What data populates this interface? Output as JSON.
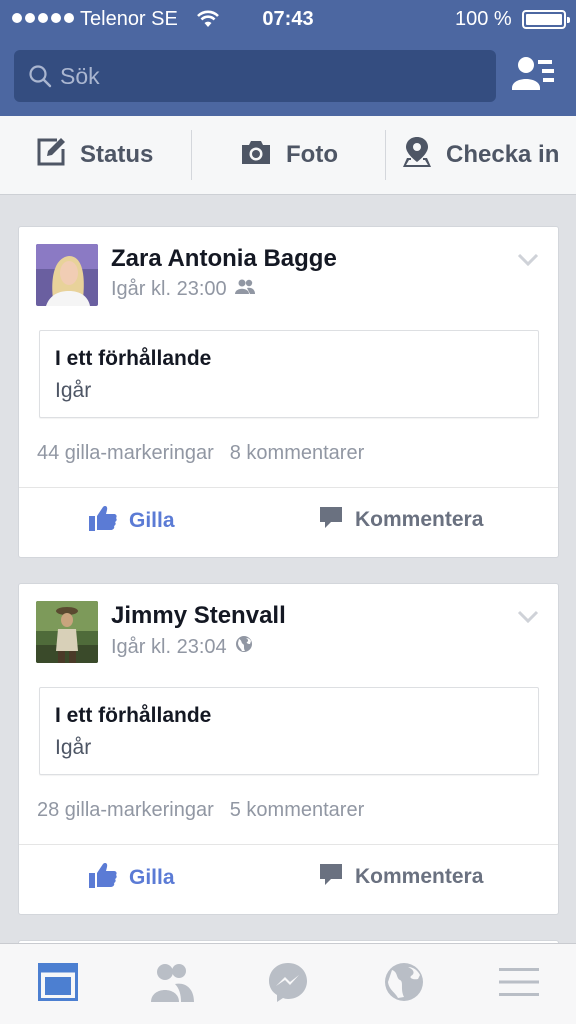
{
  "status_bar": {
    "carrier": "Telenor SE",
    "time": "07:43",
    "battery": "100 %"
  },
  "search": {
    "placeholder": "Sök"
  },
  "composer": {
    "status_label": "Status",
    "photo_label": "Foto",
    "checkin_label": "Checka in"
  },
  "posts": [
    {
      "author": "Zara Antonia Bagge",
      "time": "Igår kl. 23:00",
      "audience_icon": "friends-icon",
      "event_title": "I ett förhållande",
      "event_date": "Igår",
      "likes": "44 gilla-markeringar",
      "comments": "8 kommentarer",
      "like_label": "Gilla",
      "comment_label": "Kommentera"
    },
    {
      "author": "Jimmy Stenvall",
      "time": "Igår kl. 23:04",
      "audience_icon": "globe-icon",
      "event_title": "I ett förhållande",
      "event_date": "Igår",
      "likes": "28 gilla-markeringar",
      "comments": "5 kommentarer",
      "like_label": "Gilla",
      "comment_label": "Kommentera"
    }
  ],
  "tabbar": {
    "items": [
      "news-feed-icon",
      "friend-requests-icon",
      "messenger-icon",
      "notifications-globe-icon",
      "menu-icon"
    ],
    "active": "news-feed-icon"
  },
  "colors": {
    "header": "#4c67a1",
    "search_bg": "#344d80",
    "like_blue": "#5b7bd5",
    "background": "#dfe1e5"
  }
}
